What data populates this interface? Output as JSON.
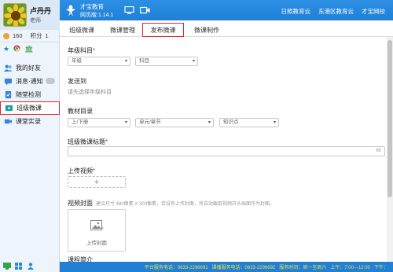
{
  "user": {
    "name": "卢丹丹",
    "role": "老师",
    "coins": "160",
    "points_label": "积分",
    "points": "1"
  },
  "nav": {
    "items": [
      {
        "label": "我的好友"
      },
      {
        "label": "消息·通知"
      },
      {
        "label": "随堂检测"
      },
      {
        "label": "班级微课"
      },
      {
        "label": "课堂实录"
      }
    ]
  },
  "header": {
    "brand": "才宝教育",
    "version": "网页版:1.14.1",
    "links": [
      "日照教育云",
      "东港区教育云",
      "才宝网校"
    ]
  },
  "tabs": [
    "班级微课",
    "微课管理",
    "发布微课",
    "微课制作"
  ],
  "form": {
    "grade_subject_label": "年级科目",
    "grade_placeholder": "年级",
    "subject_placeholder": "科目",
    "send_to_label": "发送到",
    "send_to_hint": "请先选择年级科目",
    "catalog_label": "教材目录",
    "volume_placeholder": "上/下册",
    "unit_placeholder": "单元/章节",
    "knowledge_placeholder": "知识点",
    "title_label": "班级微课标题",
    "title_counter": "60",
    "upload_label": "上传视频",
    "upload_plus": "+",
    "cover_label": "视频封面",
    "cover_hint": "建议尺寸 480像素 X 300像素，若没有上传封面，将自动截取视频开头画面作为封面。",
    "cover_upload_text": "上传封面",
    "intro_label": "课程简介"
  },
  "footer": {
    "items": [
      "平台服务电话：0633-2296691",
      "课播服务电话：0633-2296692",
      "服务时间：周一至周六",
      "上午：7:00—12:00",
      "下午："
    ]
  },
  "colors": {
    "header_blue": "#2088dd",
    "highlight_red": "#d9272e",
    "footer_text": "#ffdd33"
  }
}
